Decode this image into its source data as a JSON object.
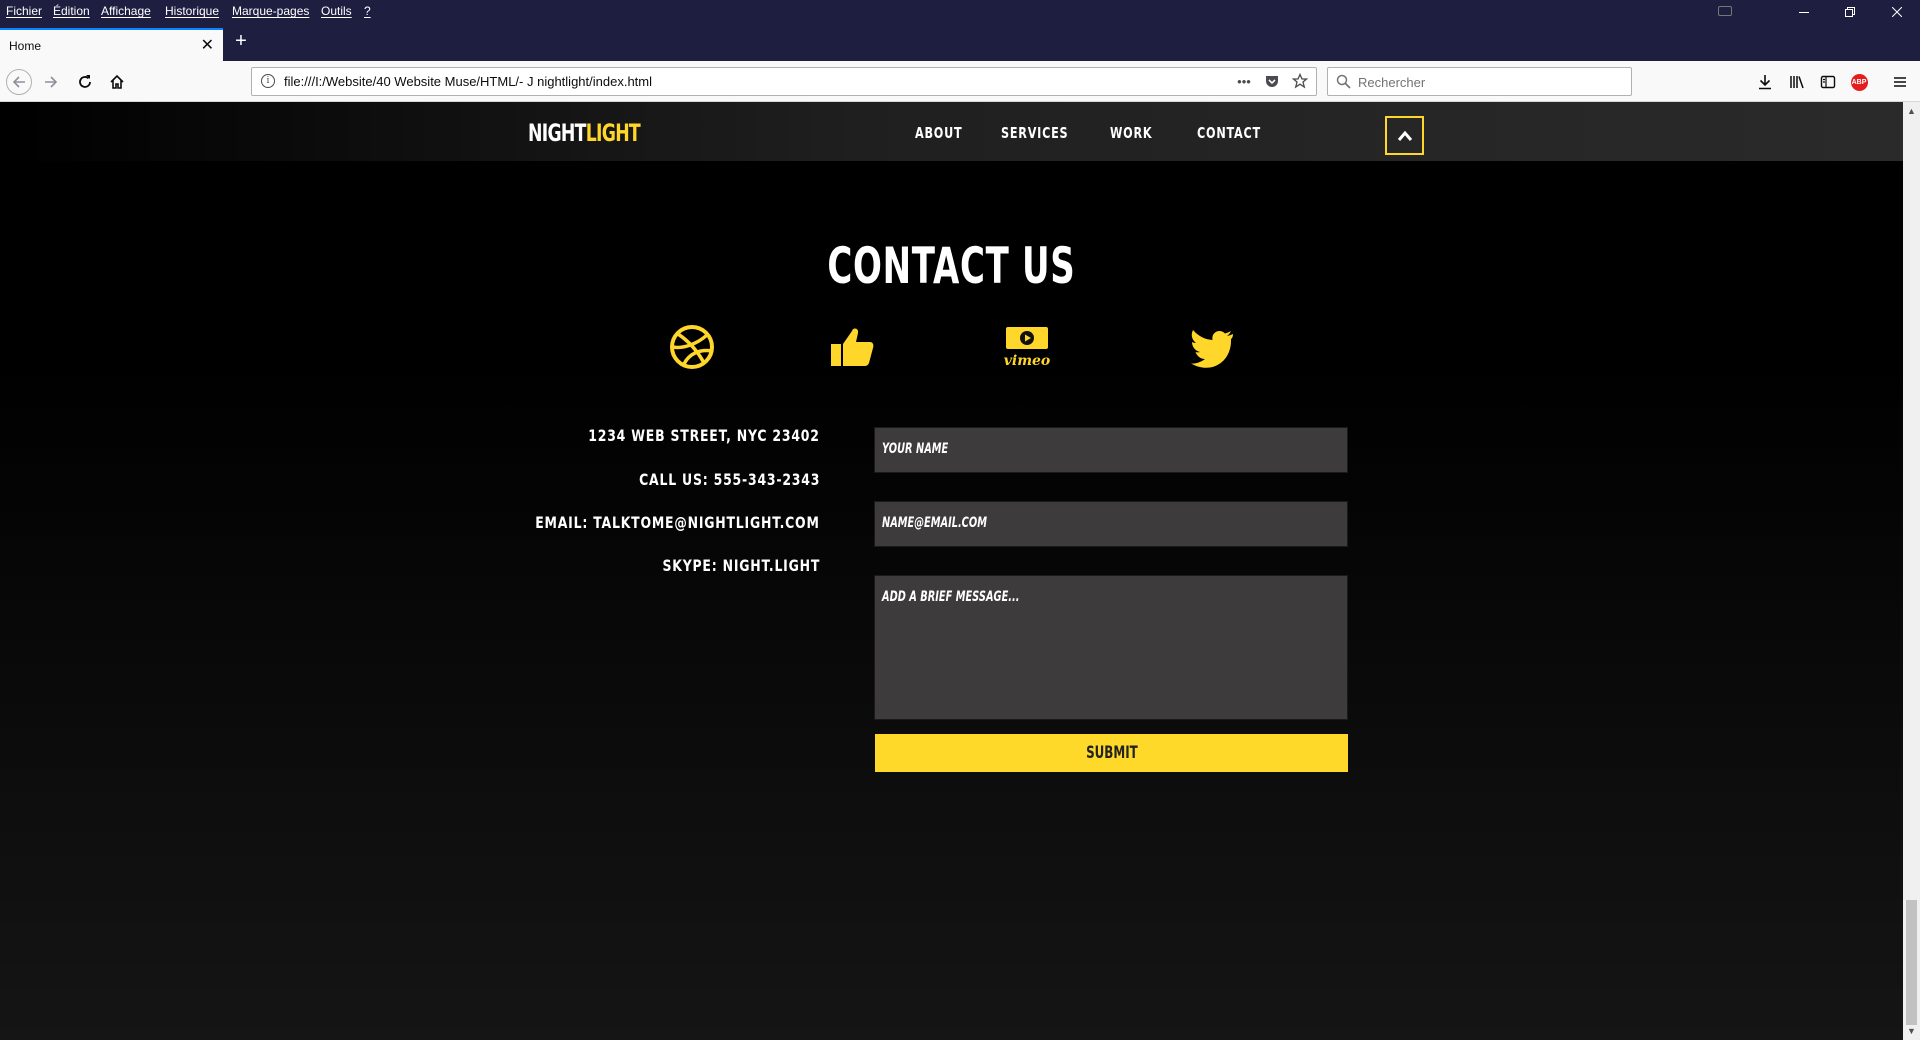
{
  "browser": {
    "menu": [
      "Fichier",
      "Édition",
      "Affichage",
      "Historique",
      "Marque-pages",
      "Outils",
      "?"
    ],
    "tab_title": "Home",
    "url": "file:///I:/Website/40 Website Muse/HTML/- J nightlight/index.html",
    "search_placeholder": "Rechercher"
  },
  "site": {
    "logo_primary": "NIGHT",
    "logo_accent": "LIGHT",
    "nav": [
      "ABOUT",
      "SERVICES",
      "WORK",
      "CONTACT"
    ],
    "section_title": "CONTACT US",
    "social_icons": [
      "dribbble-icon",
      "thumbs-up-icon",
      "vimeo-icon",
      "twitter-icon"
    ],
    "vimeo_wordmark": "vimeo",
    "contact_info": {
      "address": "1234 WEB STREET, NYC 23402",
      "phone": "CALL US: 555-343-2343",
      "email": "EMAIL: TALKTOME@NIGHTLIGHT.COM",
      "skype": "SKYPE: NIGHT.LIGHT"
    },
    "form": {
      "name_placeholder": "YOUR NAME",
      "email_placeholder": "NAME@EMAIL.COM",
      "message_placeholder": "ADD A BRIEF MESSAGE...",
      "submit_label": "SUBMIT"
    }
  },
  "colors": {
    "accent": "#ffd62a",
    "menubar": "#1e1f40",
    "field_bg": "#3d3b3c"
  }
}
